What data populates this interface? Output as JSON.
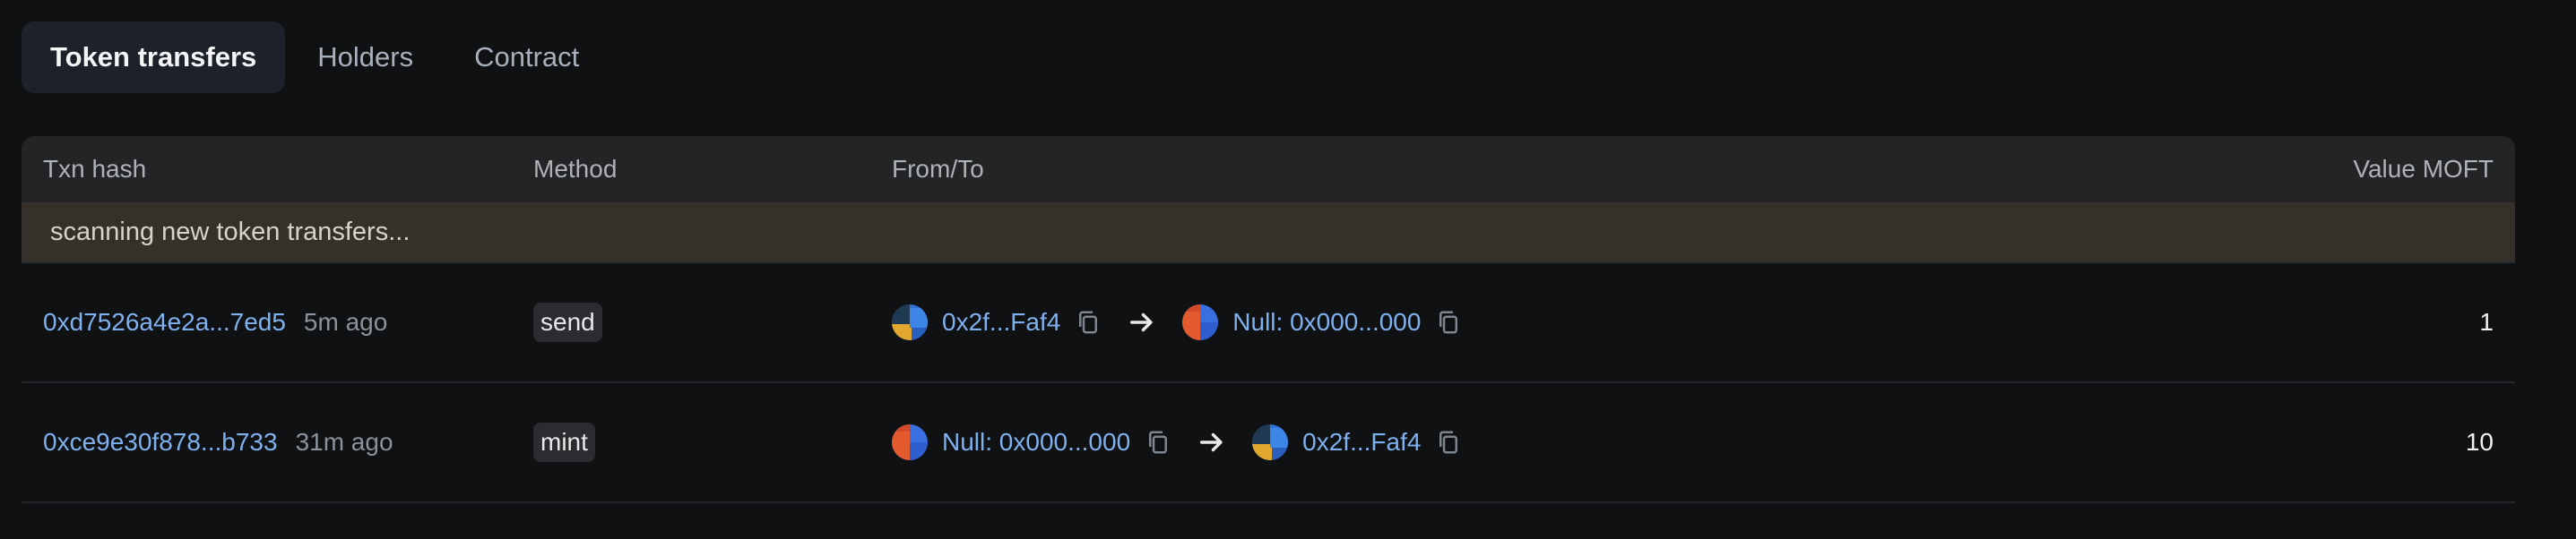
{
  "tabs": [
    {
      "label": "Token transfers",
      "active": true
    },
    {
      "label": "Holders",
      "active": false
    },
    {
      "label": "Contract",
      "active": false
    }
  ],
  "table": {
    "headers": {
      "txn_hash": "Txn hash",
      "method": "Method",
      "from_to": "From/To",
      "value": "Value MOFT"
    },
    "banner": "scanning new token transfers...",
    "rows": [
      {
        "hash": "0xd7526a4e2a...7ed5",
        "age": "5m ago",
        "method": "send",
        "from": {
          "label": "0x2f...Faf4",
          "avatar": "avatar-blue-yellow"
        },
        "to": {
          "label": "Null: 0x000...000",
          "avatar": "avatar-red-blue"
        },
        "value": "1"
      },
      {
        "hash": "0xce9e30f878...b733",
        "age": "31m ago",
        "method": "mint",
        "from": {
          "label": "Null: 0x000...000",
          "avatar": "avatar-red-blue"
        },
        "to": {
          "label": "0x2f...Faf4",
          "avatar": "avatar-blue-yellow"
        },
        "value": "10"
      }
    ]
  },
  "colors": {
    "background": "#101112",
    "link": "#7fb0ef",
    "banner": "#35302a",
    "header": "#232426",
    "active_tab": "#1d2129"
  },
  "icons": [
    "copy-icon",
    "arrow-right-icon"
  ]
}
